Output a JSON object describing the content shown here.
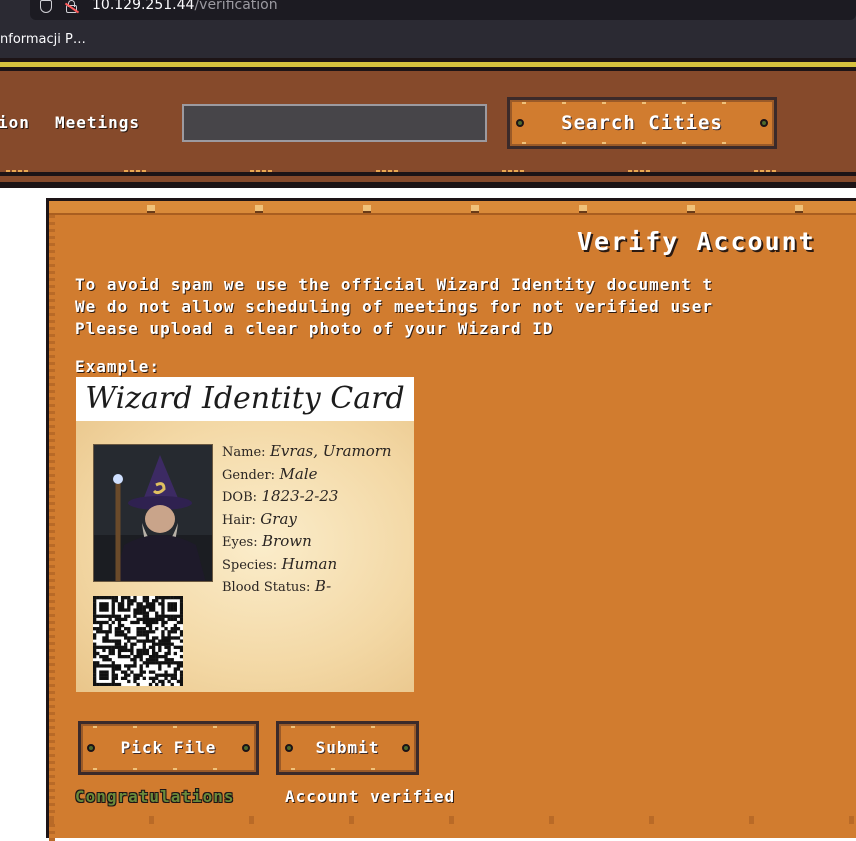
{
  "browser": {
    "url_host": "10.129.251.44",
    "url_path": "/verification",
    "bookmark": "nformacji P…"
  },
  "header": {
    "nav_partial": "ion",
    "nav_meetings": "Meetings",
    "search_value": "",
    "search_button": "Search Cities"
  },
  "verify": {
    "title": "Verify Account",
    "line1": "To avoid spam we use the official Wizard Identity document t",
    "line2": "We do not allow scheduling of meetings for not verified user",
    "line3": "Please upload a clear photo of your Wizard ID",
    "example_label": "Example:",
    "id_card": {
      "heading": "Wizard Identity Card",
      "fields": [
        {
          "key": "Name:",
          "value": "Evras, Uramorn"
        },
        {
          "key": "Gender:",
          "value": "Male"
        },
        {
          "key": "DOB:",
          "value": "1823-2-23"
        },
        {
          "key": "Hair:",
          "value": "Gray"
        },
        {
          "key": "Eyes:",
          "value": "Brown"
        },
        {
          "key": "Species:",
          "value": "Human"
        },
        {
          "key": "Blood Status:",
          "value": "B-"
        }
      ]
    },
    "pick_button": "Pick File",
    "submit_button": "Submit",
    "status_highlight": "Congratulations",
    "status_text": "Account verified"
  },
  "colors": {
    "header_brown": "#864a2b",
    "card_orange": "#d17c2f",
    "accent_yellow": "#d6c13e",
    "success_green": "#6b8a3a"
  }
}
